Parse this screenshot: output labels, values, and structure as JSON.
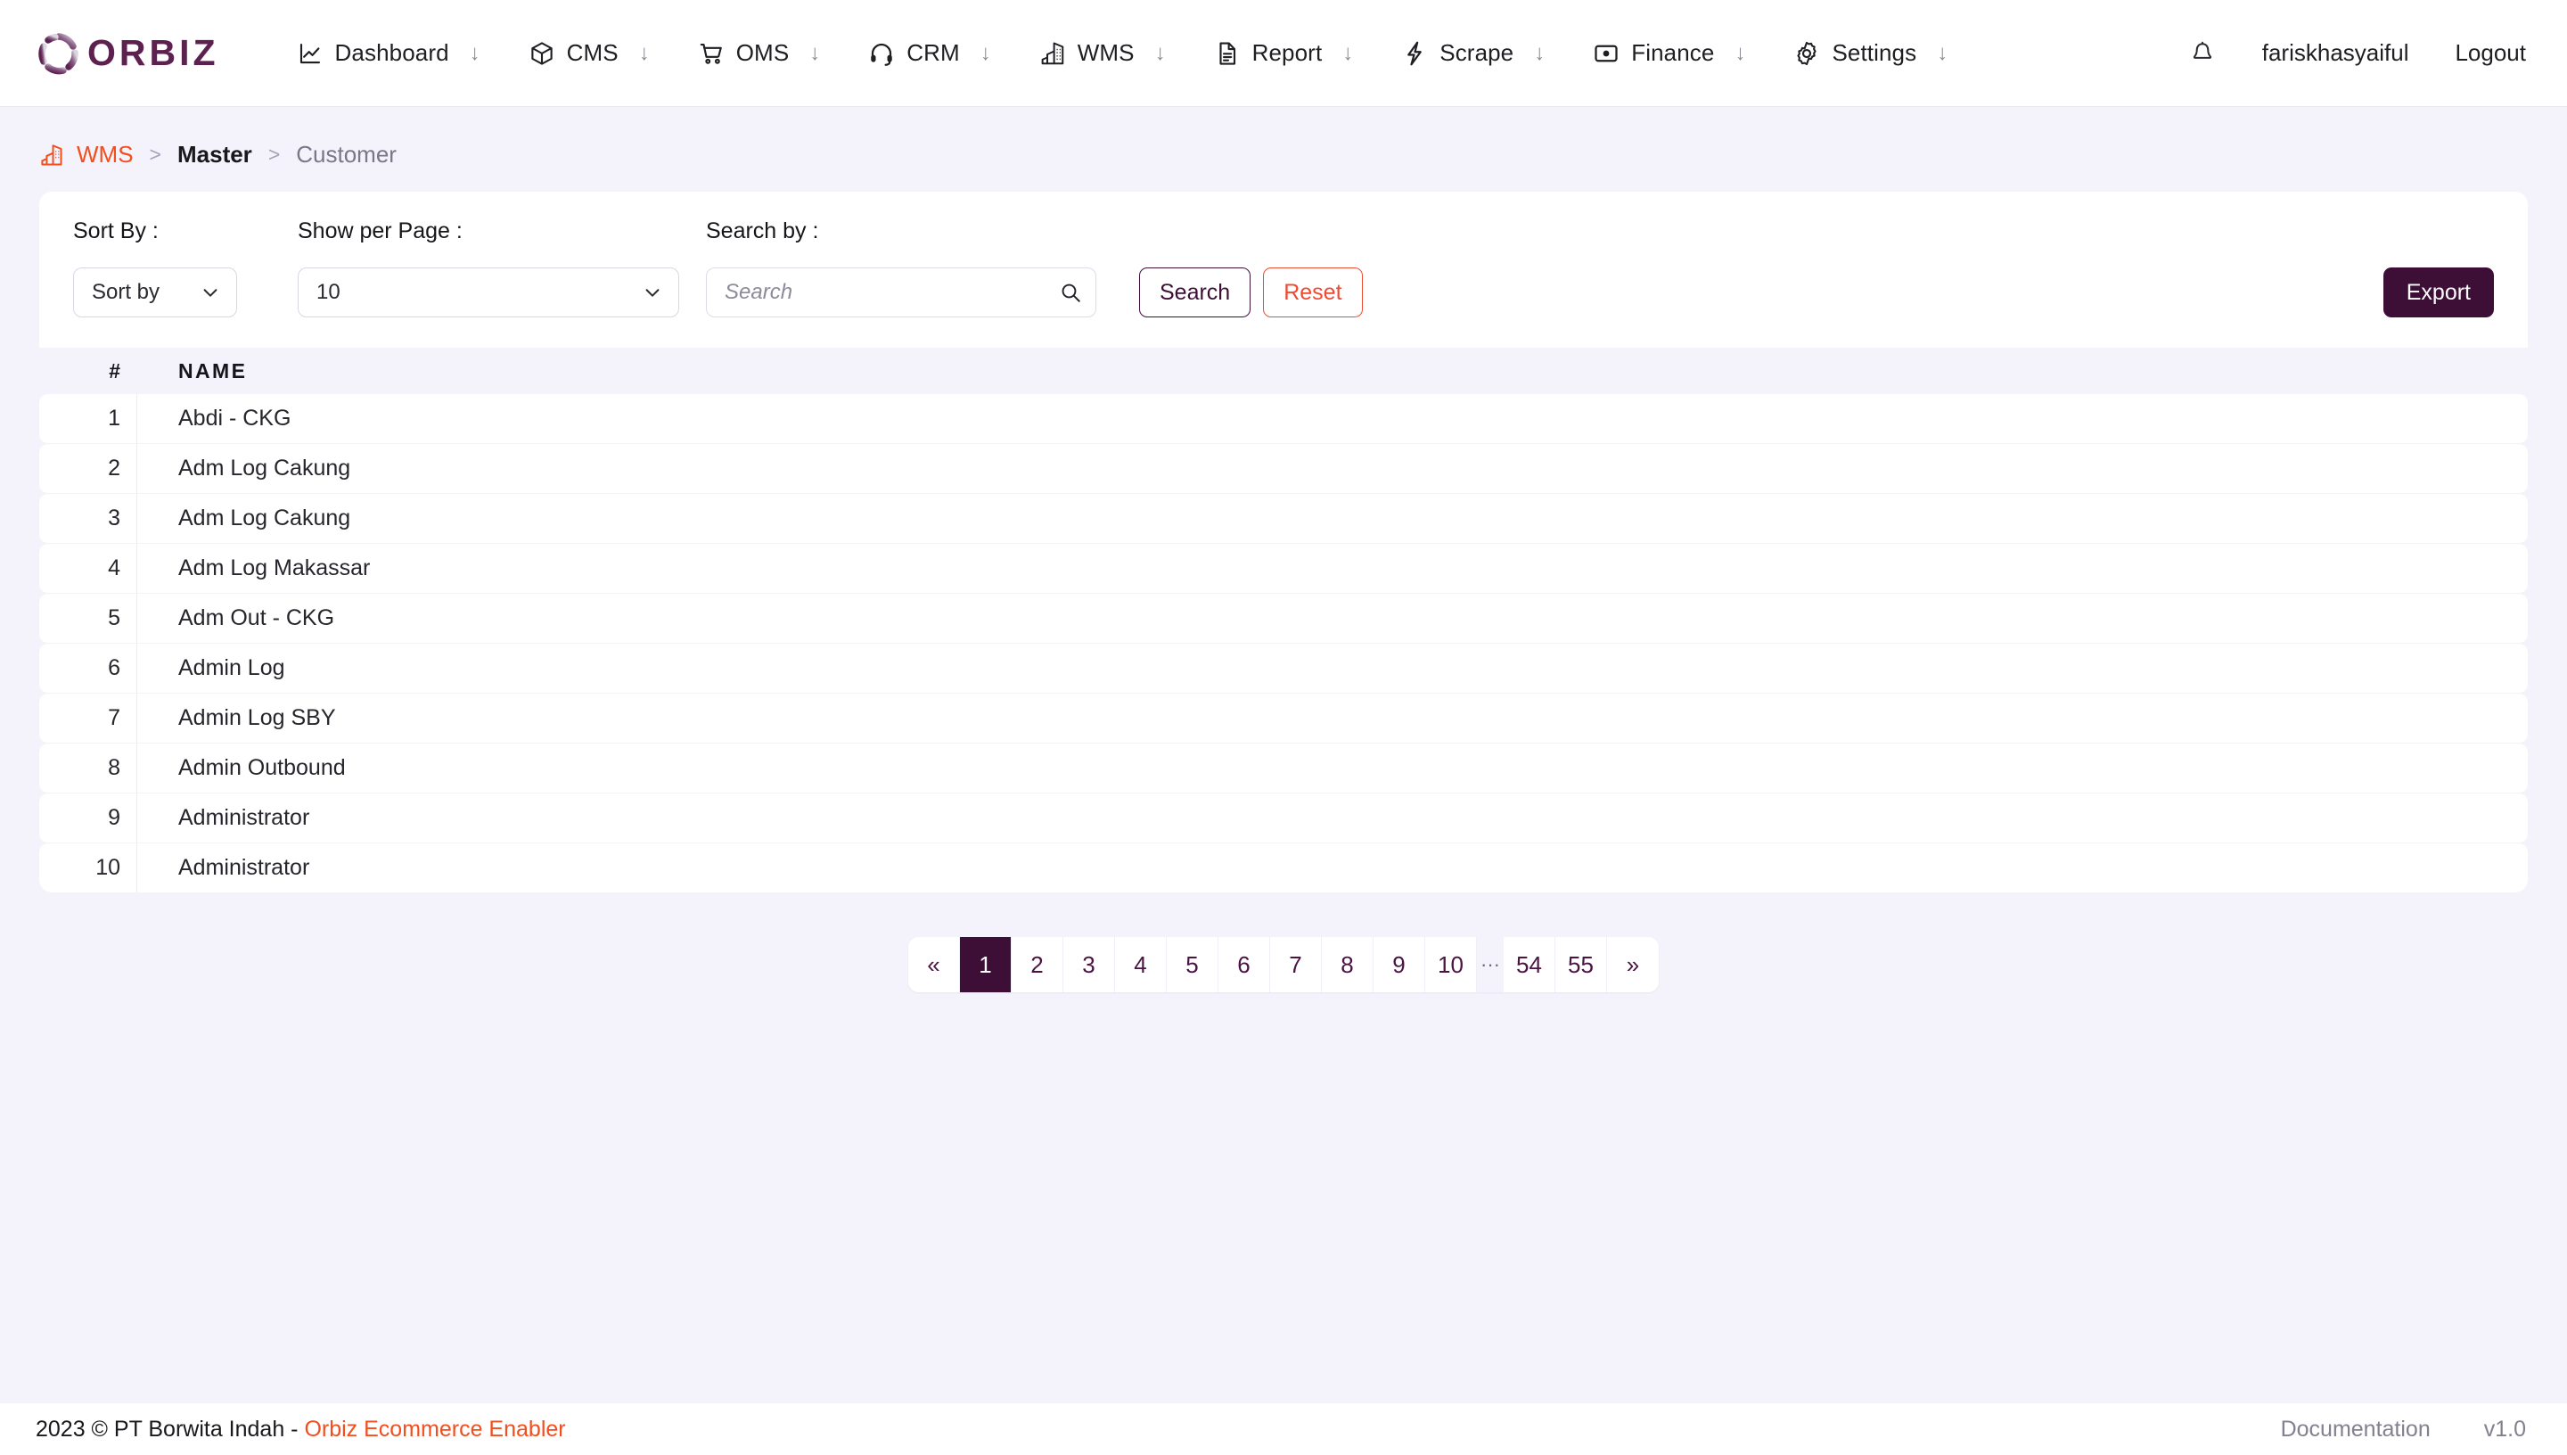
{
  "brand": {
    "name": "ORBIZ",
    "logo_icon": "orbiz-ring-logo",
    "primary_color": "#3d0e36",
    "accent_color": "#f24e1e",
    "page_bg": "#f4f2fb"
  },
  "topnav": {
    "items": [
      {
        "label": "Dashboard",
        "icon": "chart-line-icon",
        "caret": "↓"
      },
      {
        "label": "CMS",
        "icon": "box-icon",
        "caret": "↓"
      },
      {
        "label": "OMS",
        "icon": "shopping-cart-icon",
        "caret": "↓"
      },
      {
        "label": "CRM",
        "icon": "headset-icon",
        "caret": "↓"
      },
      {
        "label": "WMS",
        "icon": "warehouse-icon",
        "caret": "↓"
      },
      {
        "label": "Report",
        "icon": "document-icon",
        "caret": "↓"
      },
      {
        "label": "Scrape",
        "icon": "lightning-bolt-icon",
        "caret": "↓"
      },
      {
        "label": "Finance",
        "icon": "card-icon",
        "caret": "↓"
      },
      {
        "label": "Settings",
        "icon": "gear-icon",
        "caret": "↓"
      }
    ],
    "notification_icon": "bell-icon",
    "username": "fariskhasyaiful",
    "logout_label": "Logout"
  },
  "breadcrumb": {
    "icon": "warehouse-icon",
    "root": "WMS",
    "separator": ">",
    "middle": "Master",
    "current": "Customer"
  },
  "filters": {
    "sort_label": "Sort By :",
    "sort_value": "Sort by",
    "perpage_label": "Show per Page :",
    "perpage_value": "10",
    "search_label": "Search by :",
    "search_value": "",
    "search_placeholder": "Search",
    "search_icon": "magnifier-icon",
    "search_button": "Search",
    "reset_button": "Reset",
    "export_button": "Export"
  },
  "table": {
    "columns": [
      "#",
      "NAME"
    ],
    "rows": [
      {
        "num": "1",
        "name": "Abdi - CKG"
      },
      {
        "num": "2",
        "name": "Adm Log Cakung"
      },
      {
        "num": "3",
        "name": "Adm Log Cakung"
      },
      {
        "num": "4",
        "name": "Adm Log Makassar"
      },
      {
        "num": "5",
        "name": "Adm Out - CKG"
      },
      {
        "num": "6",
        "name": "Admin Log"
      },
      {
        "num": "7",
        "name": "Admin Log SBY"
      },
      {
        "num": "8",
        "name": "Admin Outbound"
      },
      {
        "num": "9",
        "name": "Administrator"
      },
      {
        "num": "10",
        "name": "Administrator"
      }
    ]
  },
  "pagination": {
    "prev": "«",
    "next": "»",
    "gap": "···",
    "current": "1",
    "pages": [
      "1",
      "2",
      "3",
      "4",
      "5",
      "6",
      "7",
      "8",
      "9",
      "10"
    ],
    "tail_pages": [
      "54",
      "55"
    ]
  },
  "footer": {
    "copyright": "2023 © PT Borwita Indah - ",
    "brand_link": "Orbiz Ecommerce Enabler",
    "documentation": "Documentation",
    "version": "v1.0"
  }
}
